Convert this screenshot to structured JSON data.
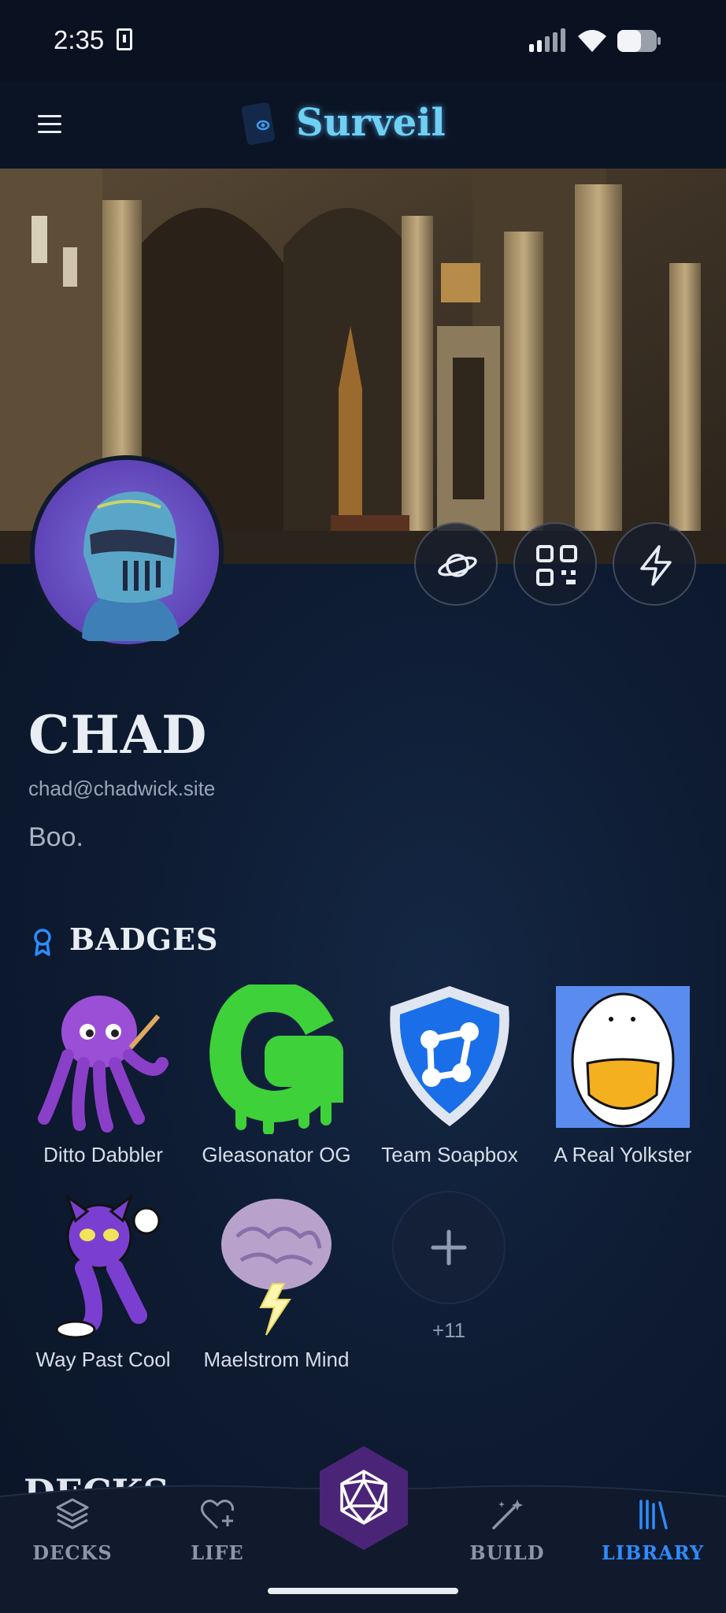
{
  "status_bar": {
    "time": "2:35"
  },
  "header": {
    "app_name": "Surveil"
  },
  "profile": {
    "name": "CHAD",
    "email": "chad@chadwick.site",
    "bio": "Boo."
  },
  "badges": {
    "title": "BADGES",
    "items": [
      {
        "label": "Ditto Dabbler"
      },
      {
        "label": "Gleasonator OG"
      },
      {
        "label": "Team Soapbox"
      },
      {
        "label": "A Real Yolkster"
      },
      {
        "label": "Way Past Cool"
      },
      {
        "label": "Maelstrom Mind"
      }
    ],
    "more_count": "+11"
  },
  "decks_section": {
    "title": "DECKS"
  },
  "bottom_nav": {
    "items": [
      {
        "label": "DECKS",
        "icon": "layers-icon"
      },
      {
        "label": "LIFE",
        "icon": "heart-plus-icon"
      },
      {
        "label": "BUILD",
        "icon": "magic-wand-icon"
      },
      {
        "label": "LIBRARY",
        "icon": "library-icon"
      }
    ],
    "active": "LIBRARY",
    "center_icon": "d20-icon"
  },
  "colors": {
    "accent": "#2f8bff",
    "background": "#0b1527",
    "center_button": "#4a2577"
  }
}
